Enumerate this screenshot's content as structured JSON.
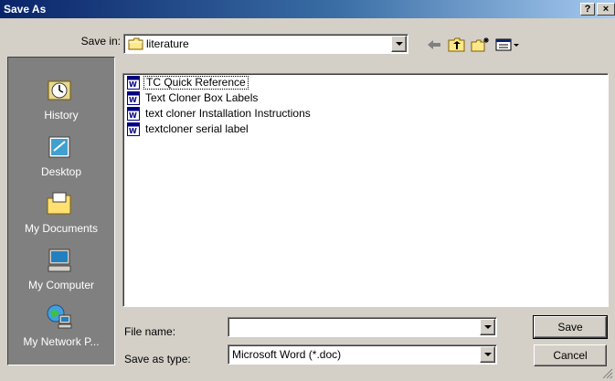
{
  "window": {
    "title": "Save As",
    "help_label": "?",
    "close_label": "×"
  },
  "save_in": {
    "label": "Save in:",
    "value": "literature"
  },
  "places": [
    {
      "label": "History",
      "icon": "history-icon"
    },
    {
      "label": "Desktop",
      "icon": "desktop-icon"
    },
    {
      "label": "My Documents",
      "icon": "my-documents-icon"
    },
    {
      "label": "My Computer",
      "icon": "my-computer-icon"
    },
    {
      "label": "My Network P...",
      "icon": "my-network-places-icon"
    }
  ],
  "files": [
    {
      "name": "TC Quick Reference",
      "icon": "word-document-icon",
      "selected": true
    },
    {
      "name": "Text Cloner Box Labels",
      "icon": "word-document-icon",
      "selected": false
    },
    {
      "name": "text cloner Installation Instructions",
      "icon": "word-document-icon",
      "selected": false
    },
    {
      "name": "textcloner serial label",
      "icon": "word-document-icon",
      "selected": false
    }
  ],
  "file_name": {
    "label": "File name:",
    "value": ""
  },
  "save_as_type": {
    "label": "Save as type:",
    "value": "Microsoft Word (*.doc)"
  },
  "buttons": {
    "save": "Save",
    "cancel": "Cancel"
  },
  "colors": {
    "titlebar_start": "#0a246a",
    "titlebar_end": "#a6caf0",
    "dialog_bg": "#d4d0c8",
    "places_bg": "#808080"
  }
}
